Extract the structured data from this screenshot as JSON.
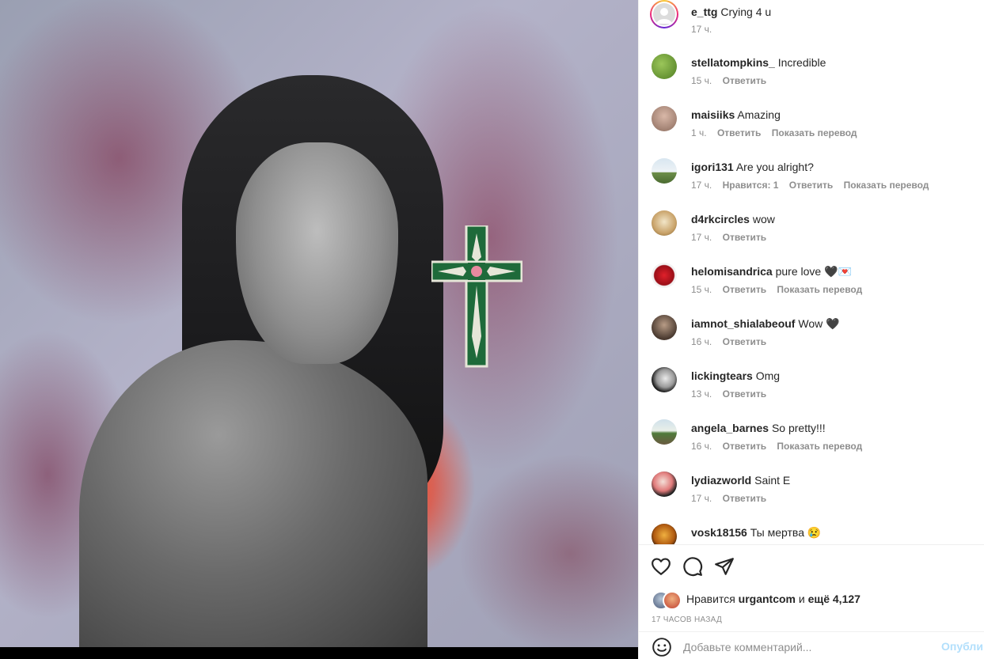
{
  "post": {
    "image_description_icon": "photo"
  },
  "caption": {
    "username": "e_ttg",
    "text": "Crying 4 u",
    "time": "17 ч."
  },
  "comments": [
    {
      "username": "stellatompkins_",
      "text": "Incredible",
      "time": "15 ч.",
      "reply": "Ответить",
      "likes": "",
      "translate": ""
    },
    {
      "username": "maisiiks",
      "text": "Amazing",
      "time": "1 ч.",
      "reply": "Ответить",
      "likes": "",
      "translate": "Показать перевод"
    },
    {
      "username": "igori131",
      "text": "Are you alright?",
      "time": "17 ч.",
      "reply": "Ответить",
      "likes": "Нравится: 1",
      "translate": "Показать перевод"
    },
    {
      "username": "d4rkcircles",
      "text": "wow",
      "time": "17 ч.",
      "reply": "Ответить",
      "likes": "",
      "translate": ""
    },
    {
      "username": "helomisandrica",
      "text": "pure love 🖤💌",
      "time": "15 ч.",
      "reply": "Ответить",
      "likes": "",
      "translate": "Показать перевод"
    },
    {
      "username": "iamnot_shialabeouf",
      "text": "Wow 🖤",
      "time": "16 ч.",
      "reply": "Ответить",
      "likes": "",
      "translate": ""
    },
    {
      "username": "lickingtears",
      "text": "Omg",
      "time": "13 ч.",
      "reply": "Ответить",
      "likes": "",
      "translate": ""
    },
    {
      "username": "angela_barnes",
      "text": "So pretty!!!",
      "time": "16 ч.",
      "reply": "Ответить",
      "likes": "",
      "translate": "Показать перевод"
    },
    {
      "username": "lydiazworld",
      "text": "Saint E",
      "time": "17 ч.",
      "reply": "Ответить",
      "likes": "",
      "translate": ""
    },
    {
      "username": "vosk18156",
      "text": "Ты мертва 😢",
      "time": "",
      "reply": "",
      "likes": "",
      "translate": ""
    }
  ],
  "actions": {
    "like_icon": "heart-icon",
    "comment_icon": "comment-bubble-icon",
    "share_icon": "paper-plane-icon"
  },
  "likes": {
    "prefix": "Нравится",
    "user": "urgantcom",
    "joiner": "и",
    "others": "ещё 4,127"
  },
  "timestamp": "17 ЧАСОВ НАЗАД",
  "comment_box": {
    "placeholder": "Добавьте комментарий...",
    "post_label": "Опубли"
  },
  "colors": {
    "link_disabled": "#b2dffc",
    "meta": "#8e8e8e",
    "text": "#262626"
  }
}
